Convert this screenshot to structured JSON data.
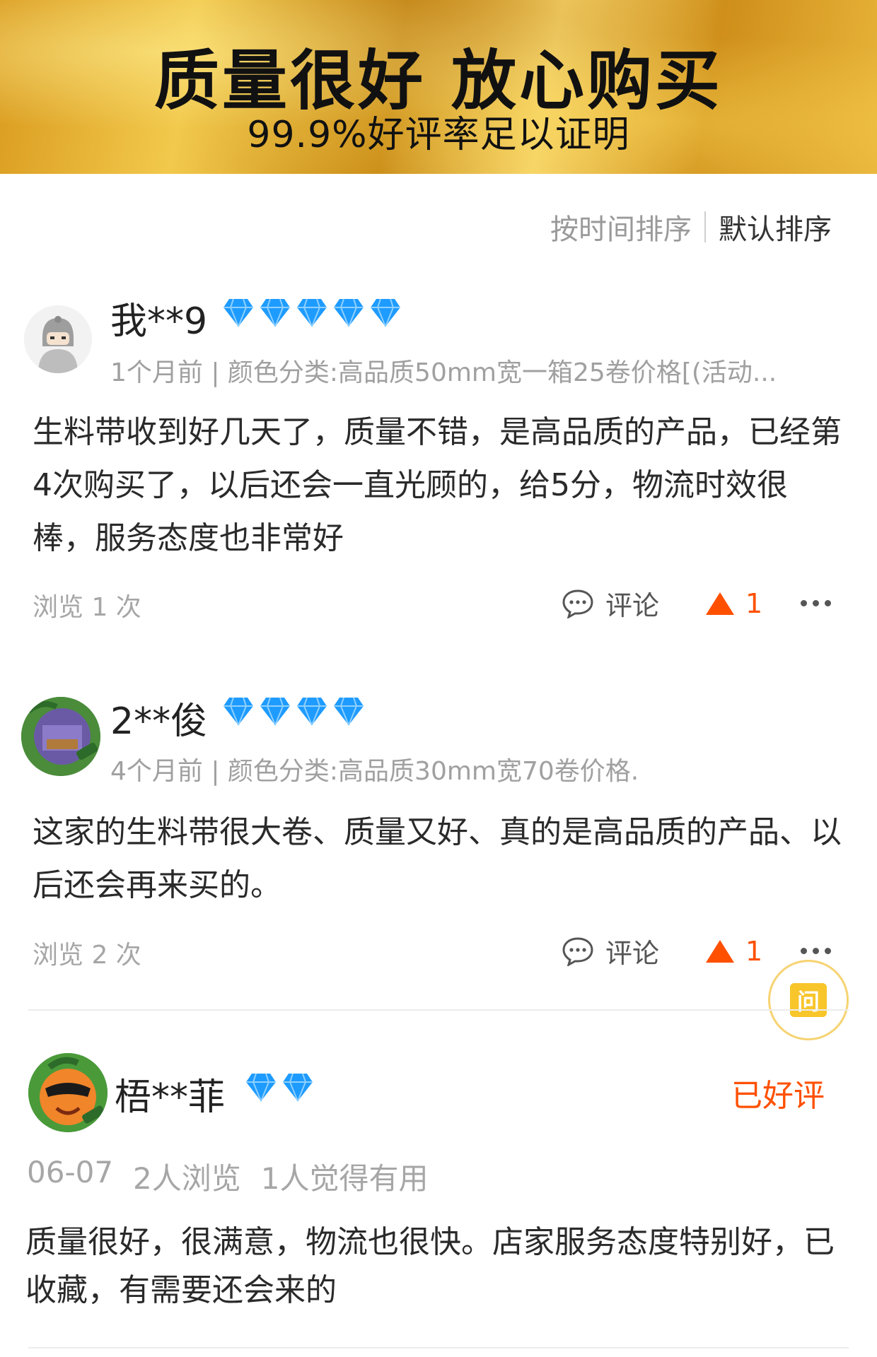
{
  "banner": {
    "headline": "质量很好 放心购买",
    "subline": "99.9%好评率足以证明"
  },
  "sort": {
    "by_time": "按时间排序",
    "default": "默认排序"
  },
  "reviews": [
    {
      "username": "我**9",
      "diamond_count": 5,
      "meta": "1个月前 | 颜色分类:高品质50mm宽一箱25卷价格[(活动...",
      "text": "生料带收到好几天了，质量不错，是高品质的产品，已经第4次购买了，以后还会一直光顾的，给5分，物流时效很棒，服务态度也非常好",
      "views": "浏览 1 次",
      "comment_label": "评论",
      "likes": "1"
    },
    {
      "username": "2**俊",
      "diamond_count": 4,
      "meta": "4个月前 | 颜色分类:高品质30mm宽70卷价格.",
      "text": "这家的生料带很大卷、质量又好、真的是高品质的产品、以后还会再来买的。",
      "views": "浏览 2 次",
      "comment_label": "评论",
      "likes": "1"
    },
    {
      "username": "梧**菲",
      "diamond_count": 2,
      "badge": "已好评",
      "date": "06-07",
      "view_count": "2人浏览",
      "useful": "1人觉得有用",
      "text": "质量很好，很满意，物流也很快。店家服务态度特别好，已收藏，有需要还会来的"
    }
  ],
  "ask_button": "问",
  "colors": {
    "accent": "#ff5000",
    "diamond": "#1e9bff",
    "banner_gold": "#e8b43a"
  }
}
